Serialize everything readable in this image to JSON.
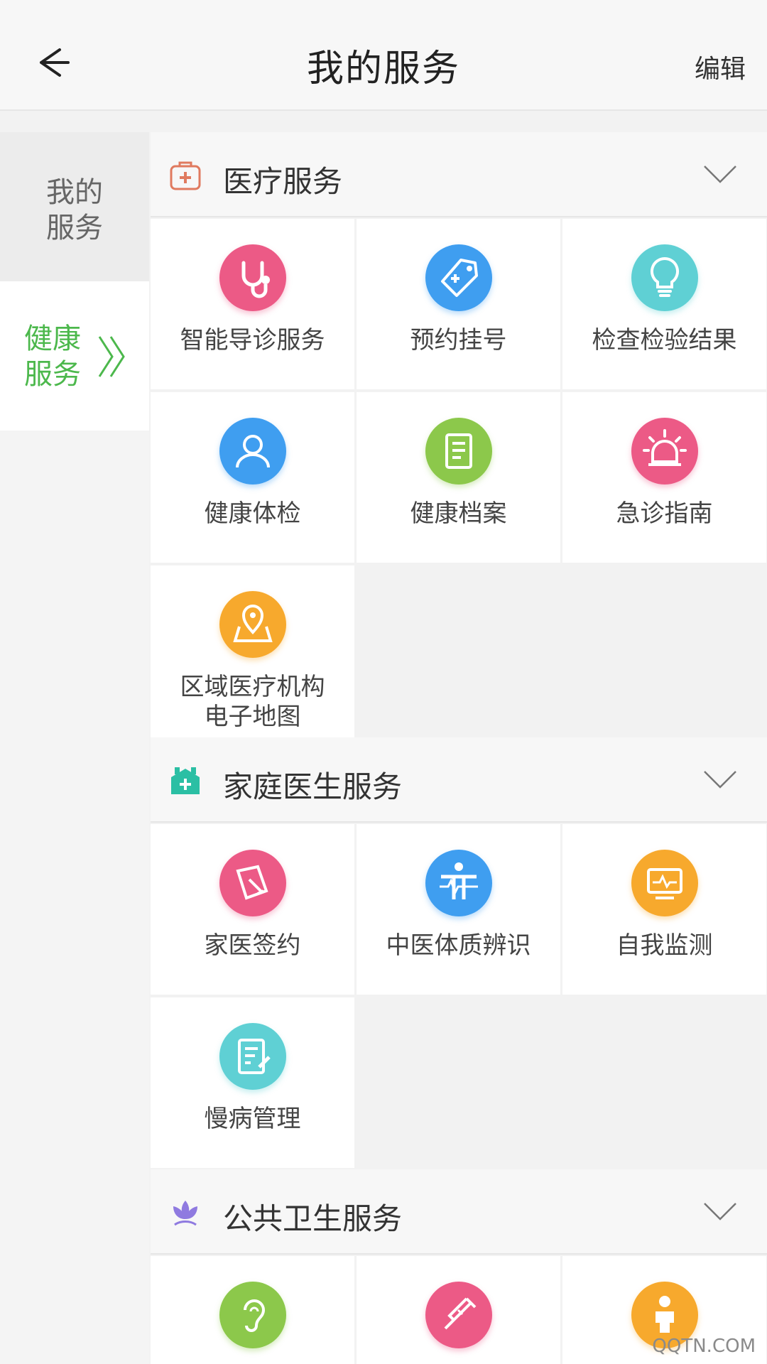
{
  "header": {
    "title": "我的服务",
    "edit_label": "编辑"
  },
  "sidebar": {
    "items": [
      {
        "label": "我的\n服务"
      },
      {
        "label": "健康\n服务"
      }
    ]
  },
  "sections": [
    {
      "title": "医疗服务",
      "icon": "medical-kit-icon",
      "items": [
        {
          "label": "智能导诊服务",
          "icon": "stethoscope-icon",
          "color": "#ec5a86"
        },
        {
          "label": "预约挂号",
          "icon": "tag-icon",
          "color": "#3f9ef0"
        },
        {
          "label": "检查检验结果",
          "icon": "lightbulb-icon",
          "color": "#5fd0d4"
        },
        {
          "label": "健康体检",
          "icon": "person-icon",
          "color": "#3f9ef0"
        },
        {
          "label": "健康档案",
          "icon": "document-icon",
          "color": "#8cc84b"
        },
        {
          "label": "急诊指南",
          "icon": "siren-icon",
          "color": "#ec5a86"
        },
        {
          "label": "区域医疗机构\n电子地图",
          "icon": "map-pin-icon",
          "color": "#f7a92d"
        }
      ]
    },
    {
      "title": "家庭医生服务",
      "icon": "house-medical-icon",
      "items": [
        {
          "label": "家医签约",
          "icon": "sign-icon",
          "color": "#ec5a86"
        },
        {
          "label": "中医体质辨识",
          "icon": "body-pulse-icon",
          "color": "#3f9ef0"
        },
        {
          "label": "自我监测",
          "icon": "monitor-icon",
          "color": "#f7a92d"
        },
        {
          "label": "慢病管理",
          "icon": "notes-icon",
          "color": "#5fd0d4"
        }
      ]
    },
    {
      "title": "公共卫生服务",
      "icon": "lotus-icon",
      "items": [
        {
          "label": "",
          "icon": "ear-icon",
          "color": "#8cc84b"
        },
        {
          "label": "",
          "icon": "syringe-icon",
          "color": "#ec5a86"
        },
        {
          "label": "",
          "icon": "child-icon",
          "color": "#f7a92d"
        }
      ]
    }
  ],
  "watermark": "QQTN.COM"
}
